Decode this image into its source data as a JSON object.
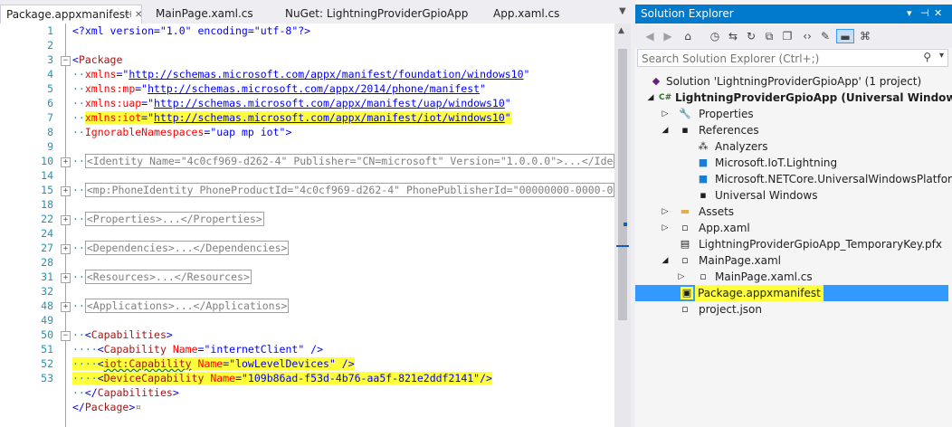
{
  "tabs": [
    {
      "label": "Package.appxmanifest"
    },
    {
      "label": "MainPage.xaml.cs"
    },
    {
      "label": "NuGet: LightningProviderGpioApp"
    },
    {
      "label": "App.xaml.cs"
    }
  ],
  "editor": {
    "lines": [
      {
        "n": "1"
      },
      {
        "n": "2"
      },
      {
        "n": "3"
      },
      {
        "n": "4"
      },
      {
        "n": "5"
      },
      {
        "n": "6"
      },
      {
        "n": "7"
      },
      {
        "n": "8"
      },
      {
        "n": "9"
      },
      {
        "n": "10"
      },
      {
        "n": "14"
      },
      {
        "n": "15"
      },
      {
        "n": "18"
      },
      {
        "n": "22"
      },
      {
        "n": "24"
      },
      {
        "n": "27"
      },
      {
        "n": "28"
      },
      {
        "n": "31"
      },
      {
        "n": "32"
      },
      {
        "n": "48"
      },
      {
        "n": "49"
      },
      {
        "n": "50"
      },
      {
        "n": "51"
      },
      {
        "n": "52"
      },
      {
        "n": "53"
      }
    ],
    "xml_decl": "<?xml version=\"1.0\" encoding=\"utf-8\"?>",
    "ns_foundation": "http://schemas.microsoft.com/appx/manifest/foundation/windows10",
    "ns_mp": "http://schemas.microsoft.com/appx/2014/phone/manifest",
    "ns_uap": "http://schemas.microsoft.com/appx/manifest/uap/windows10",
    "ns_iot": "http://schemas.microsoft.com/appx/manifest/iot/windows10",
    "ignorable": "uap mp iot",
    "identity": "<Identity Name=\"4c0cf969-d262-4\" Publisher=\"CN=microsoft\" Version=\"1.0.0.0\">...</Ide",
    "phone_identity": "<mp:PhoneIdentity PhoneProductId=\"4c0cf969-d262-4\" PhonePublisherId=\"00000000-0000-0",
    "properties": "<Properties>...</Properties>",
    "dependencies": "<Dependencies>...</Dependencies>",
    "resources": "<Resources>...</Resources>",
    "applications": "<Applications>...</Applications>",
    "cap_internet": "internetClient",
    "cap_lowlevel": "lowLevelDevices",
    "device_cap": "109b86ad-f53d-4b76-aa5f-821e2ddf2141"
  },
  "solution_explorer": {
    "title": "Solution Explorer",
    "search_placeholder": "Search Solution Explorer (Ctrl+;)",
    "items": [
      {
        "label": "Solution 'LightningProviderGpioApp' (1 project)"
      },
      {
        "label": "LightningProviderGpioApp (Universal Windows)"
      },
      {
        "label": "Properties"
      },
      {
        "label": "References"
      },
      {
        "label": "Analyzers"
      },
      {
        "label": "Microsoft.IoT.Lightning"
      },
      {
        "label": "Microsoft.NETCore.UniversalWindowsPlatform"
      },
      {
        "label": "Universal Windows"
      },
      {
        "label": "Assets"
      },
      {
        "label": "App.xaml"
      },
      {
        "label": "LightningProviderGpioApp_TemporaryKey.pfx"
      },
      {
        "label": "MainPage.xaml"
      },
      {
        "label": "MainPage.xaml.cs"
      },
      {
        "label": "Package.appxmanifest"
      },
      {
        "label": "project.json"
      }
    ]
  },
  "colors": {
    "accent": "#007acc",
    "highlight": "#ffff3c",
    "selection": "#3399ff"
  }
}
